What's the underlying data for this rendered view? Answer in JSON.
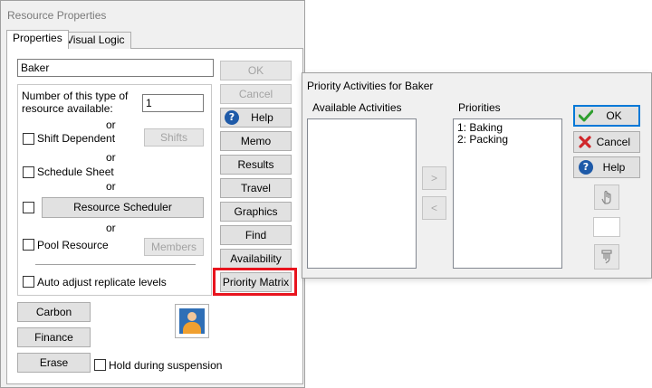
{
  "resource_window": {
    "title": "Resource Properties",
    "tabs": [
      "Properties",
      "Visual Logic"
    ],
    "name_value": "Baker",
    "num_label": "Number of this type of resource available:",
    "num_value": "1",
    "or_text": "or",
    "shift_dependent": "Shift Dependent",
    "shifts_button": "Shifts",
    "schedule_sheet": "Schedule Sheet",
    "resource_scheduler": "Resource Scheduler",
    "pool_resource": "Pool Resource",
    "members_button": "Members",
    "auto_adjust": "Auto adjust replicate levels",
    "side_buttons": {
      "ok": "OK",
      "cancel": "Cancel",
      "help": "Help",
      "memo": "Memo",
      "results": "Results",
      "travel": "Travel",
      "graphics": "Graphics",
      "find": "Find",
      "availability": "Availability",
      "priority_matrix": "Priority Matrix"
    },
    "bottom_buttons": {
      "carbon": "Carbon",
      "finance": "Finance",
      "erase": "Erase"
    },
    "hold_during_suspension": "Hold during suspension"
  },
  "priority_dialog": {
    "title": "Priority Activities for Baker",
    "available_label": "Available Activities",
    "priorities_label": "Priorities",
    "priorities": [
      "1: Baking",
      "2: Packing"
    ],
    "ok": "OK",
    "cancel": "Cancel",
    "help": "Help",
    "move_right": ">",
    "move_left": "<"
  },
  "colors": {
    "highlight": "#e8141e",
    "ok_check": "#2e9e2e",
    "cancel_x": "#d0262a",
    "help": "#1e5aa8"
  }
}
